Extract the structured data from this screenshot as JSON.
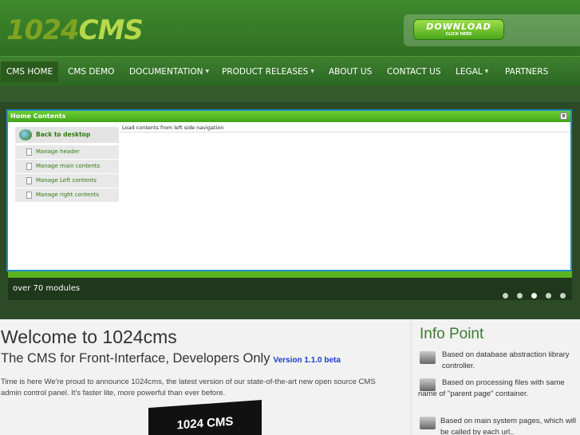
{
  "logo": {
    "num": "1024",
    "cms": "CMS"
  },
  "download": {
    "label": "DOWNLOAD",
    "sub": "CLICK HERE"
  },
  "nav": {
    "items": [
      {
        "label": "CMS HOME"
      },
      {
        "label": "CMS DEMO"
      },
      {
        "label": "DOCUMENTATION"
      },
      {
        "label": "PRODUCT RELEASES"
      },
      {
        "label": "ABOUT US"
      },
      {
        "label": "CONTACT US"
      },
      {
        "label": "LEGAL"
      },
      {
        "label": "PARTNERS"
      }
    ]
  },
  "screen": {
    "title": "Home Contents",
    "close": "x",
    "back": "Back to desktop",
    "items": [
      "Manage header",
      "Manage main contents",
      "Manage Left contents",
      "Manage right contents"
    ],
    "hint": "Load contents from left side navigation"
  },
  "slider": {
    "caption": "over 70 modules",
    "dots": 5,
    "active_dot": 2
  },
  "welcome": {
    "title": "Welcome to 1024cms",
    "subtitle": "The CMS for Front-Interface, Developers Only",
    "version": "Version 1.1.0 beta",
    "intro": "Time is here We're proud to announce 1024cms, the latest version of our state-of-the-art new open source CMS admin control panel. It's faster lite, more powerful than ever before.",
    "box_label": "1024 CMS"
  },
  "info": {
    "title": "Info Point",
    "items": [
      "Based on database abstraction library controller.",
      "Based on processing files with same name of \"parent page\" container.",
      "Based on main system pages, which will be called by each url.."
    ]
  }
}
